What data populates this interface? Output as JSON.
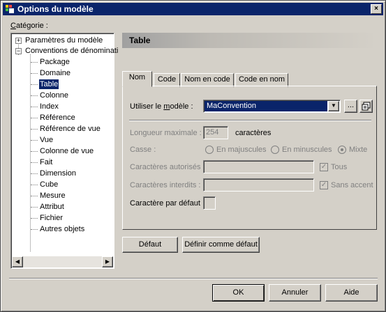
{
  "window": {
    "title": "Options du modèle",
    "close_label": "×"
  },
  "category": {
    "label_prefix": "C",
    "label_rest": "atégorie :"
  },
  "tree": {
    "root1": "Paramètres du modèle",
    "root2": "Conventions de dénominati",
    "items": [
      "Package",
      "Domaine",
      "Table",
      "Colonne",
      "Index",
      "Référence",
      "Référence de vue",
      "Vue",
      "Colonne de vue",
      "Fait",
      "Dimension",
      "Cube",
      "Mesure",
      "Attribut",
      "Fichier",
      "Autres objets"
    ],
    "selected": "Table"
  },
  "header": {
    "title": "Table"
  },
  "tabs": [
    "Nom",
    "Code",
    "Nom en code",
    "Code en nom"
  ],
  "form": {
    "template_label_a": "Utiliser le ",
    "template_label_u": "m",
    "template_label_b": "odèle  :",
    "template_value": "MaConvention",
    "ellipsis": "...",
    "maxlen_label": "Longueur maximale :",
    "maxlen_value": "254",
    "maxlen_unit": "caractères",
    "case_label": "Casse :",
    "case_upper": "En majuscules",
    "case_lower": "En minuscules",
    "case_mixed": "Mixte",
    "allowed_label": "Caractères autorisés :",
    "all_label": "Tous",
    "forbidden_label": "Caractères interdits :",
    "no_accent_label": "Sans accent",
    "default_char_label": "Caractère par défaut :"
  },
  "buttons": {
    "default": "Défaut",
    "set_default": "Définir comme défaut",
    "ok": "OK",
    "cancel": "Annuler",
    "help": "Aide"
  },
  "colors": {
    "titlebar": "#0a246a",
    "face": "#d4d0c8"
  }
}
